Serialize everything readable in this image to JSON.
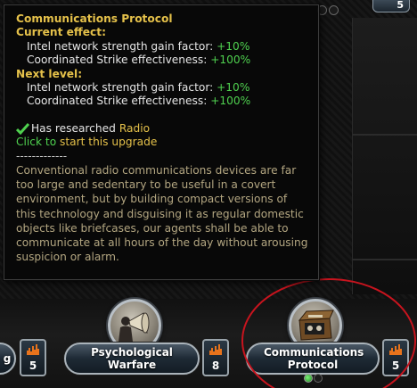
{
  "tooltip": {
    "title": "Communications Protocol",
    "current_effect_heading": "Current effect:",
    "current_effects": [
      {
        "label": "Intel network strength gain factor:",
        "value": "+10%"
      },
      {
        "label": "Coordinated Strike effectiveness:",
        "value": "+100%"
      }
    ],
    "next_level_heading": "Next level:",
    "next_level_effects": [
      {
        "label": "Intel network strength gain factor:",
        "value": "+10%"
      },
      {
        "label": "Coordinated Strike effectiveness:",
        "value": "+100%"
      }
    ],
    "requirement_text": "Has researched",
    "requirement_tech": "Radio",
    "click_prefix": "Click to",
    "click_action": "start this upgrade",
    "separator": "-------------",
    "description": "Conventional radio communications devices are far too large and sedentary to be useful in a covert environment, but by building compact versions of this technology and disguising it as regular domestic objects like briefcases, our agents shall be able to communicate at all hours of the day without arousing suspicion or alarm."
  },
  "top_badge": {
    "value": "5"
  },
  "upgrades": [
    {
      "name": "g",
      "cost": "5"
    },
    {
      "name": "Psychological Warfare",
      "cost": "8"
    },
    {
      "name": "Communications Protocol",
      "cost": "5"
    }
  ],
  "colors": {
    "accent_gold": "#e5c14a",
    "positive_green": "#4fd14f",
    "highlight_red": "#c8141e",
    "description_tan": "#b3a681"
  },
  "icons": [
    "check-icon",
    "megaphone-icon",
    "radio-briefcase-icon",
    "intel-cost-icon"
  ]
}
